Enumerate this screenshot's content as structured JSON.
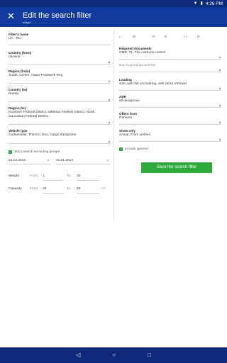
{
  "status": {
    "time": "4:26 PM"
  },
  "appbar": {
    "title": "Edit the search filter",
    "subtitle": "freight"
  },
  "left": {
    "filter_name": {
      "label": "Filter's name",
      "value": "UA - RU"
    },
    "country_from": {
      "label": "Country (from)",
      "value": "Ukraine"
    },
    "region_from": {
      "label": "Region (from)",
      "value": "South, Centre, Ivano-Frankivsk Reg"
    },
    "country_to": {
      "label": "Country (to)",
      "value": "Russia"
    },
    "region_to": {
      "label": "Region (to)",
      "value": "Southern Federal District, Siberian Federal District, North Caucasian Federal District"
    },
    "vehicle_type": {
      "label": "Vehicle type",
      "value": "Curtainsider, Thermo, Box, Cargo transporter"
    },
    "strict_search": "Strict search excluding groups",
    "date_from": "22.12.2016",
    "date_to": "31.01.2017",
    "weight": {
      "label": "Weight",
      "from_label": "From:",
      "from": "1",
      "to_label": "To:",
      "to": "20"
    },
    "capacity": {
      "label": "Capacity",
      "from_label": "From:",
      "from": "20",
      "to_label": "To:",
      "to": "50",
      "unit": "m³"
    }
  },
  "right": {
    "dims": {
      "l": "L:",
      "l_val": "0",
      "w": "W:",
      "w_val": "0",
      "h": "H:",
      "h_val": "0"
    },
    "required_documents": {
      "label": "Required documents",
      "value": "CMR, T1, The customs control"
    },
    "not_required": "Not required documents",
    "loading": {
      "label": "Loading",
      "value": "side, with full uncovering, with racks removal"
    },
    "adr": {
      "label": "ADR",
      "value": "all dangerous"
    },
    "offers_from": {
      "label": "Offers from",
      "value": "Partners"
    },
    "show_only": {
      "label": "Show only",
      "value": "Actual, From verified"
    },
    "include_ignored": "Include ignored",
    "save_button": "Save the search filter"
  },
  "icons": {
    "close": "close-icon",
    "back": "back-icon",
    "home": "home-icon",
    "recent": "recent-apps-icon"
  },
  "colors": {
    "appbar": "#123a9e",
    "statusbar": "#0d2a78",
    "accent": "#2eaa3a"
  }
}
